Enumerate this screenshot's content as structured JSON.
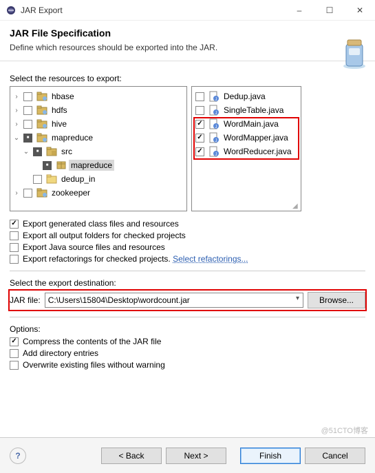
{
  "window": {
    "title": "JAR Export",
    "minimize": "–",
    "maximize": "☐",
    "close": "✕"
  },
  "header": {
    "title": "JAR File Specification",
    "subtitle": "Define which resources should be exported into the JAR."
  },
  "resources_label": "Select the resources to export:",
  "left_tree": [
    {
      "indent": 0,
      "twisty": "›",
      "check": "off",
      "icon": "project",
      "label": "hbase"
    },
    {
      "indent": 0,
      "twisty": "›",
      "check": "off",
      "icon": "project",
      "label": "hdfs"
    },
    {
      "indent": 0,
      "twisty": "›",
      "check": "off",
      "icon": "project",
      "label": "hive"
    },
    {
      "indent": 0,
      "twisty": "⌄",
      "check": "filled",
      "icon": "project",
      "label": "mapreduce"
    },
    {
      "indent": 1,
      "twisty": "⌄",
      "check": "filled",
      "icon": "srcfolder",
      "label": "src"
    },
    {
      "indent": 2,
      "twisty": "",
      "check": "filled",
      "icon": "package",
      "label": "mapreduce",
      "selected": true
    },
    {
      "indent": 1,
      "twisty": "",
      "check": "off",
      "icon": "folder",
      "label": "dedup_in"
    },
    {
      "indent": 0,
      "twisty": "›",
      "check": "off",
      "icon": "project",
      "label": "zookeeper"
    }
  ],
  "right_tree": [
    {
      "check": "off",
      "icon": "java",
      "label": "Dedup.java"
    },
    {
      "check": "off",
      "icon": "java",
      "label": "SingleTable.java"
    },
    {
      "check": "on",
      "icon": "java",
      "label": "WordMain.java"
    },
    {
      "check": "on",
      "icon": "java",
      "label": "WordMapper.java"
    },
    {
      "check": "on",
      "icon": "java",
      "label": "WordReducer.java"
    }
  ],
  "export_options": {
    "generated": {
      "checked": true,
      "label": "Export generated class files and resources"
    },
    "all_output": {
      "checked": false,
      "label": "Export all output folders for checked projects"
    },
    "java_src": {
      "checked": false,
      "label": "Export Java source files and resources"
    },
    "refactorings": {
      "checked": false,
      "label": "Export refactorings for checked projects.",
      "link": "Select refactorings..."
    }
  },
  "destination": {
    "label": "Select the export destination:",
    "field_label": "JAR file:",
    "value": "C:\\Users\\15804\\Desktop\\wordcount.jar",
    "browse": "Browse..."
  },
  "options": {
    "heading": "Options:",
    "compress": {
      "checked": true,
      "label": "Compress the contents of the JAR file"
    },
    "add_dir": {
      "checked": false,
      "label": "Add directory entries"
    },
    "overwrite": {
      "checked": false,
      "label": "Overwrite existing files without warning"
    }
  },
  "footer": {
    "back": "< Back",
    "next": "Next >",
    "finish": "Finish",
    "cancel": "Cancel"
  },
  "watermark": "@51CTO博客"
}
